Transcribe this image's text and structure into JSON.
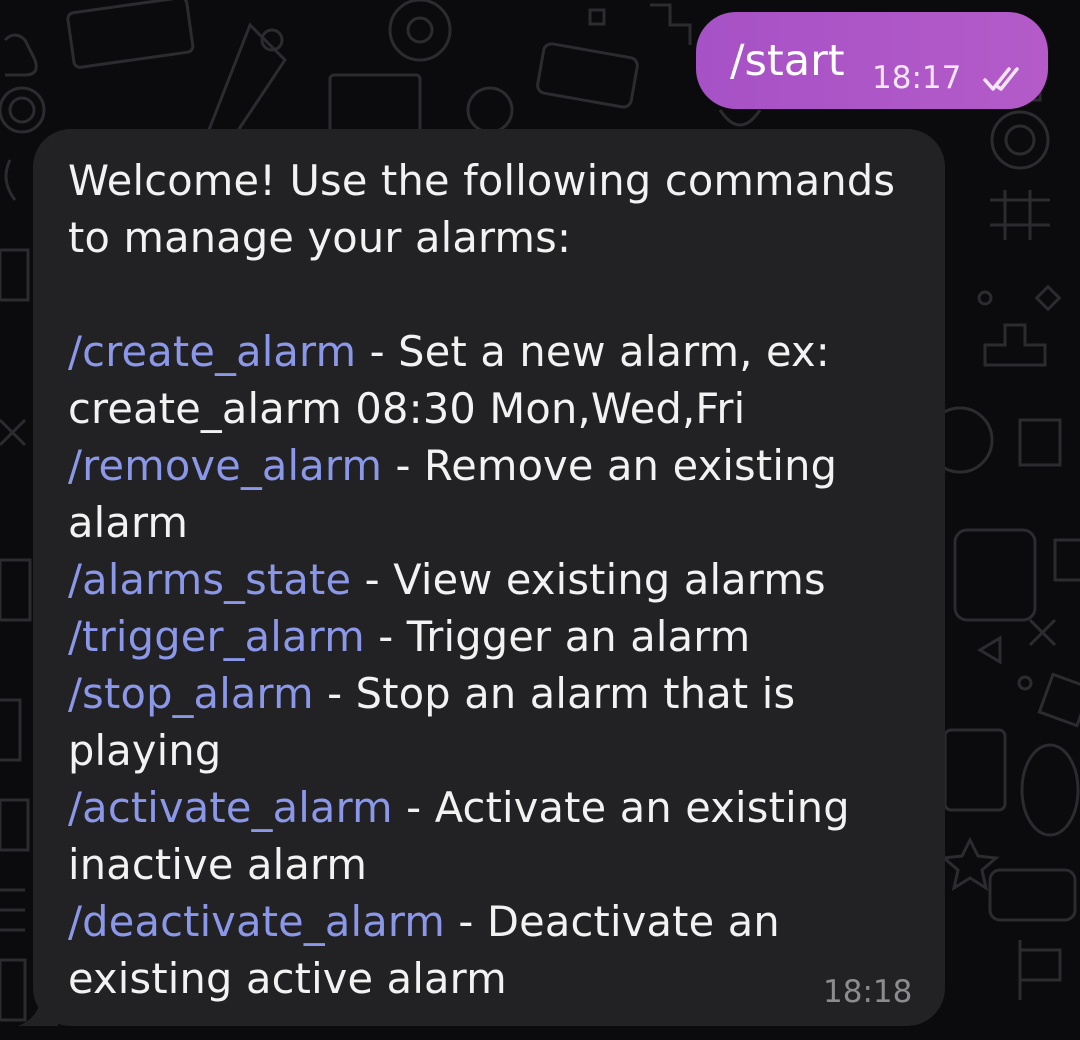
{
  "outgoing_message": {
    "text": "/start",
    "time": "18:17",
    "status_icon": "double-check-icon"
  },
  "incoming_message": {
    "intro_line_1": "Welcome! Use the following commands",
    "intro_line_2": "to manage your alarms:",
    "commands": [
      {
        "command": "/create_alarm",
        "desc_line_1": " - Set a new alarm, ex:",
        "desc_line_2": "create_alarm 08:30 Mon,Wed,Fri"
      },
      {
        "command": "/remove_alarm",
        "desc_line_1": " - Remove an existing",
        "desc_line_2": "alarm"
      },
      {
        "command": "/alarms_state",
        "desc_line_1": " - View existing alarms"
      },
      {
        "command": "/trigger_alarm",
        "desc_line_1": " - Trigger an alarm"
      },
      {
        "command": "/stop_alarm",
        "desc_line_1": " - Stop an alarm that is",
        "desc_line_2": "playing"
      },
      {
        "command": "/activate_alarm",
        "desc_line_1": " - Activate an existing",
        "desc_line_2": "inactive alarm"
      },
      {
        "command": "/deactivate_alarm",
        "desc_line_1": " - Deactivate an",
        "desc_line_2": "existing active alarm"
      }
    ],
    "time": "18:18"
  },
  "colors": {
    "background": "#0b0b0d",
    "outgoing_bubble": "#ad56c8",
    "incoming_bubble": "#222224",
    "command_link": "#8b97e8",
    "text": "#f2f2f2",
    "timestamp_incoming": "#8c8c90"
  }
}
